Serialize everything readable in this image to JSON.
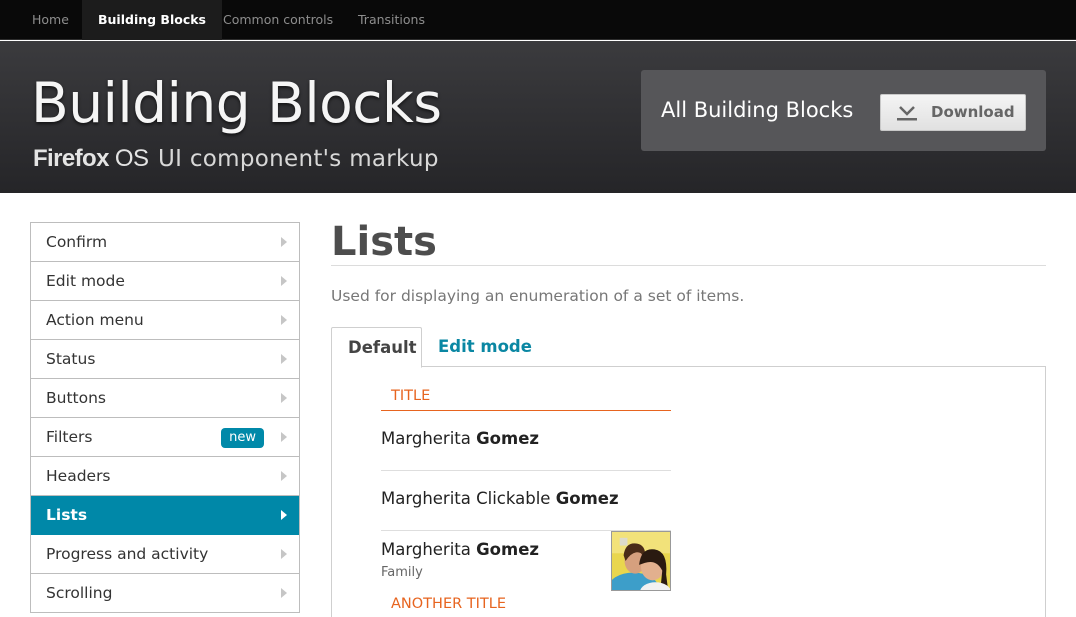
{
  "topnav": {
    "items": [
      {
        "label": "Home"
      },
      {
        "label": "Building Blocks"
      },
      {
        "label": "Common controls"
      },
      {
        "label": "Transitions"
      }
    ]
  },
  "banner": {
    "title": "Building Blocks",
    "brand": "Firefox",
    "brand_os": "OS",
    "subtitle": "UI component's markup",
    "download_box_label": "All Building Blocks",
    "download_button": "Download"
  },
  "sidebar": {
    "items": [
      {
        "label": "Confirm"
      },
      {
        "label": "Edit mode"
      },
      {
        "label": "Action menu"
      },
      {
        "label": "Status"
      },
      {
        "label": "Buttons"
      },
      {
        "label": "Filters",
        "badge": "new"
      },
      {
        "label": "Headers"
      },
      {
        "label": "Lists"
      },
      {
        "label": "Progress and activity"
      },
      {
        "label": "Scrolling"
      }
    ]
  },
  "main": {
    "title": "Lists",
    "description": "Used for displaying an enumeration of a set of items.",
    "tabs": [
      {
        "label": "Default"
      },
      {
        "label": "Edit mode"
      }
    ],
    "list": {
      "header": "TITLE",
      "items": [
        {
          "first": "Margherita",
          "last": "Gomez"
        },
        {
          "first": "Margherita Clickable",
          "last": "Gomez"
        },
        {
          "first": "Margherita",
          "last": "Gomez",
          "sub": "Family"
        }
      ],
      "header2": "ANOTHER TITLE"
    }
  },
  "colors": {
    "accent": "#0088a8",
    "list_title": "#e7641f",
    "topnav_bg": "#090909",
    "banner_bg": "#333336"
  }
}
